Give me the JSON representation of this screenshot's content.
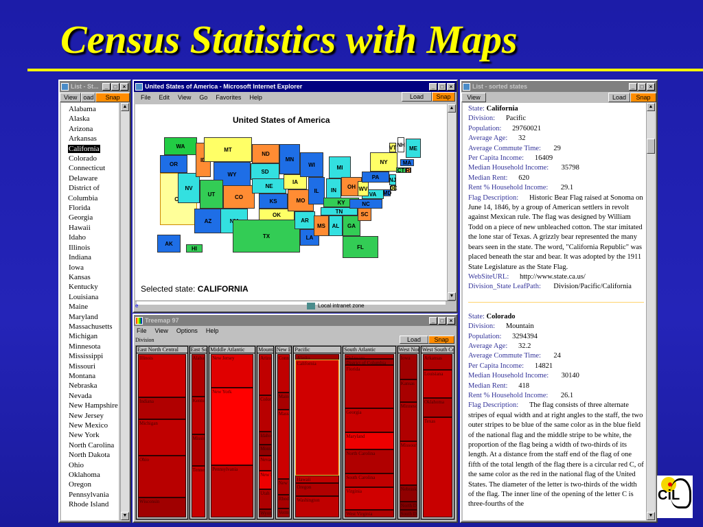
{
  "slide": {
    "title": "Census Statistics with Maps"
  },
  "left_list": {
    "title": "List - St...",
    "view": "View",
    "load": "oad",
    "snap": "Snap",
    "items": [
      "Alabama",
      "Alaska",
      "Arizona",
      "Arkansas",
      "California",
      "Colorado",
      "Connecticut",
      "Delaware",
      "District of Columbia",
      "Florida",
      "Georgia",
      "Hawaii",
      "Idaho",
      "Illinois",
      "Indiana",
      "Iowa",
      "Kansas",
      "Kentucky",
      "Louisiana",
      "Maine",
      "Maryland",
      "Massachusetts",
      "Michigan",
      "Minnesota",
      "Mississippi",
      "Missouri",
      "Montana",
      "Nebraska",
      "Nevada",
      "New Hampshire",
      "New Jersey",
      "New Mexico",
      "New York",
      "North Carolina",
      "North Dakota",
      "Ohio",
      "Oklahoma",
      "Oregon",
      "Pennsylvania",
      "Rhode Island"
    ],
    "selected": "California"
  },
  "ie": {
    "title": "United States of America - Microsoft Internet Explorer",
    "menu": [
      "File",
      "Edit",
      "View",
      "Go",
      "Favorites",
      "Help"
    ],
    "load": "Load",
    "snap": "Snap",
    "map_title": "United States of America",
    "selected_label": "Selected state:",
    "selected_value": "CALIFORNIA",
    "status_zone": "Local intranet zone",
    "states": [
      {
        "id": "WA",
        "color": "#22cc44"
      },
      {
        "id": "OR",
        "color": "#1e6ee6"
      },
      {
        "id": "CA",
        "color": "#ffff99"
      },
      {
        "id": "NV",
        "color": "#33e0e0"
      },
      {
        "id": "ID",
        "color": "#ff8c33"
      },
      {
        "id": "MT",
        "color": "#ffff66"
      },
      {
        "id": "WY",
        "color": "#1e6ee6"
      },
      {
        "id": "UT",
        "color": "#33cc55"
      },
      {
        "id": "AZ",
        "color": "#1e6ee6"
      },
      {
        "id": "CO",
        "color": "#ff8c33"
      },
      {
        "id": "NM",
        "color": "#33e0e0"
      },
      {
        "id": "ND",
        "color": "#ff8c33"
      },
      {
        "id": "SD",
        "color": "#33e0e0"
      },
      {
        "id": "NE",
        "color": "#33e0e0"
      },
      {
        "id": "KS",
        "color": "#1e6ee6"
      },
      {
        "id": "OK",
        "color": "#ffff66"
      },
      {
        "id": "TX",
        "color": "#33cc55"
      },
      {
        "id": "MN",
        "color": "#1e6ee6"
      },
      {
        "id": "IA",
        "color": "#ffff66"
      },
      {
        "id": "MO",
        "color": "#ff8c33"
      },
      {
        "id": "AR",
        "color": "#33e0e0"
      },
      {
        "id": "LA",
        "color": "#1e6ee6"
      },
      {
        "id": "WI",
        "color": "#1e6ee6"
      },
      {
        "id": "IL",
        "color": "#1e6ee6"
      },
      {
        "id": "MI",
        "color": "#33e0e0"
      },
      {
        "id": "IN",
        "color": "#33e0e0"
      },
      {
        "id": "OH",
        "color": "#ff8c33"
      },
      {
        "id": "KY",
        "color": "#33cc55"
      },
      {
        "id": "TN",
        "color": "#33e0e0"
      },
      {
        "id": "MS",
        "color": "#ff8c33"
      },
      {
        "id": "AL",
        "color": "#33e0e0"
      },
      {
        "id": "GA",
        "color": "#33cc55"
      },
      {
        "id": "FL",
        "color": "#33cc55"
      },
      {
        "id": "SC",
        "color": "#ff8c33"
      },
      {
        "id": "NC",
        "color": "#1e6ee6"
      },
      {
        "id": "VA",
        "color": "#33e0e0"
      },
      {
        "id": "WV",
        "color": "#ffff66"
      },
      {
        "id": "PA",
        "color": "#1e6ee6"
      },
      {
        "id": "NY",
        "color": "#ffff66"
      },
      {
        "id": "VT",
        "color": "#ffff66"
      },
      {
        "id": "NH",
        "color": "#ffffff"
      },
      {
        "id": "ME",
        "color": "#33e0e0"
      },
      {
        "id": "MA",
        "color": "#1e6ee6"
      },
      {
        "id": "CT",
        "color": "#33cc55"
      },
      {
        "id": "RI",
        "color": "#ff8c33"
      },
      {
        "id": "NJ",
        "color": "#33e0e0"
      },
      {
        "id": "DE",
        "color": "#ffff66"
      },
      {
        "id": "MD",
        "color": "#1e6ee6"
      },
      {
        "id": "AK",
        "color": "#1e6ee6"
      },
      {
        "id": "HI",
        "color": "#33cc55"
      }
    ]
  },
  "treemap": {
    "title": "Treemap 97",
    "menu": [
      "File",
      "View",
      "Options",
      "Help"
    ],
    "group_label": "Division",
    "load": "Load",
    "snap": "Snap",
    "divisions": [
      {
        "name": "East North Central",
        "states": [
          {
            "n": "Illinois",
            "c": "#cc0000"
          },
          {
            "n": "Indiana",
            "c": "#b00000"
          },
          {
            "n": "Michigan",
            "c": "#c00000"
          },
          {
            "n": "Ohio",
            "c": "#b80000"
          },
          {
            "n": "Wisconsin",
            "c": "#a00000"
          }
        ]
      },
      {
        "name": "East South Central",
        "states": [
          {
            "n": "Alabama",
            "c": "#b00000"
          },
          {
            "n": "Kentucky",
            "c": "#c00000"
          },
          {
            "n": "Mississippi",
            "c": "#b00000"
          },
          {
            "n": "Tennessee",
            "c": "#c80000"
          }
        ]
      },
      {
        "name": "Middle Atlantic",
        "states": [
          {
            "n": "New Jersey",
            "c": "#e00000"
          },
          {
            "n": "New York",
            "c": "#ff0000"
          },
          {
            "n": "Pennsylvania",
            "c": "#c00000"
          }
        ]
      },
      {
        "name": "Mountain",
        "states": [
          {
            "n": "Arizona",
            "c": "#c00000"
          },
          {
            "n": "Colorado",
            "c": "#b80000"
          },
          {
            "n": "Idaho",
            "c": "#a00000"
          },
          {
            "n": "Montana",
            "c": "#900000"
          },
          {
            "n": "Nevada",
            "c": "#c00000"
          },
          {
            "n": "New Mexico",
            "c": "#ee0000"
          },
          {
            "n": "Utah",
            "c": "#b00000"
          },
          {
            "n": "Wyoming",
            "c": "#900000"
          }
        ]
      },
      {
        "name": "New England",
        "states": [
          {
            "n": "Connecticut",
            "c": "#c00000"
          },
          {
            "n": "Maine",
            "c": "#a80000"
          },
          {
            "n": "Massachusetts",
            "c": "#cc0000"
          },
          {
            "n": "New Hampshire",
            "c": "#b00000"
          },
          {
            "n": "Rhode Island",
            "c": "#a80000"
          },
          {
            "n": "Vermont",
            "c": "#a00000"
          }
        ]
      },
      {
        "name": "Pacific",
        "states": [
          {
            "n": "Alaska",
            "c": "#a00000"
          },
          {
            "n": "California",
            "c": "#d00000"
          },
          {
            "n": "Hawaii",
            "c": "#c00000"
          },
          {
            "n": "Oregon",
            "c": "#b00000"
          },
          {
            "n": "Washington",
            "c": "#c00000"
          }
        ]
      },
      {
        "name": "South Atlantic",
        "states": [
          {
            "n": "Delaware",
            "c": "#b00000"
          },
          {
            "n": "District of Columbia",
            "c": "#a00000"
          },
          {
            "n": "Florida",
            "c": "#c00000"
          },
          {
            "n": "Georgia",
            "c": "#c80000"
          },
          {
            "n": "Maryland",
            "c": "#ee0000"
          },
          {
            "n": "North Carolina",
            "c": "#b00000"
          },
          {
            "n": "South Carolina",
            "c": "#c00000"
          },
          {
            "n": "Virginia",
            "c": "#d00000"
          },
          {
            "n": "West Virginia",
            "c": "#b00000"
          }
        ]
      },
      {
        "name": "West North Central",
        "states": [
          {
            "n": "Iowa",
            "c": "#a00000"
          },
          {
            "n": "Kansas",
            "c": "#a80000"
          },
          {
            "n": "Minnesota",
            "c": "#b00000"
          },
          {
            "n": "Missouri",
            "c": "#c00000"
          },
          {
            "n": "Nebraska",
            "c": "#900000"
          },
          {
            "n": "North Dakota",
            "c": "#800000"
          },
          {
            "n": "South Dakota",
            "c": "#800000"
          }
        ]
      },
      {
        "name": "West South Central",
        "states": [
          {
            "n": "Arkansas",
            "c": "#b00000"
          },
          {
            "n": "Louisiana",
            "c": "#c80000"
          },
          {
            "n": "Oklahoma",
            "c": "#b00000"
          },
          {
            "n": "Texas",
            "c": "#c80000"
          }
        ]
      }
    ]
  },
  "right_list": {
    "title": "List - sorted states",
    "view": "View",
    "load": "Load",
    "snap": "Snap",
    "records": [
      {
        "state_label": "State:",
        "state": "California",
        "fields": [
          [
            "Division:",
            "Pacific"
          ],
          [
            "Population:",
            "29760021"
          ],
          [
            "Average Age:",
            "32"
          ],
          [
            "Average Commute Time:",
            "29"
          ],
          [
            "Per Capita Income:",
            "16409"
          ],
          [
            "Median Household Income:",
            "35798"
          ],
          [
            "Median Rent:",
            "620"
          ],
          [
            "Rent % Household Income:",
            "29.1"
          ],
          [
            "Flag Description:",
            "Historic Bear Flag raised at Sonoma on June 14, 1846, by a group of American settlers in revolt against Mexican rule. The flag was designed by William Todd on a piece of new unbleached cotton. The star imitated the lone star of Texas. A grizzly bear represented the many bears seen in the state. The word, \"California Republic\" was placed beneath the star and bear. It was adopted by the 1911 State Legislature as the State Flag."
          ],
          [
            "WebSiteURL:",
            "http://www.state.ca.us/"
          ],
          [
            "Division_State LeafPath:",
            "Division/Pacific/California"
          ]
        ]
      },
      {
        "state_label": "State:",
        "state": "Colorado",
        "fields": [
          [
            "Division:",
            "Mountain"
          ],
          [
            "Population:",
            "3294394"
          ],
          [
            "Average Age:",
            "32.2"
          ],
          [
            "Average Commute Time:",
            "24"
          ],
          [
            "Per Capita Income:",
            "14821"
          ],
          [
            "Median Household Income:",
            "30140"
          ],
          [
            "Median Rent:",
            "418"
          ],
          [
            "Rent % Household Income:",
            "26.1"
          ],
          [
            "Flag Description:",
            "The flag consists of three alternate stripes of equal width and at right angles to the staff, the two outer stripes to be blue of the same color as in the blue field of the national flag and the middle stripe to be white, the proportion of the flag being a width of two-thirds of its length. At a distance from the staff end of the flag of one fifth of the total length of the flag there is a circular red C, of the same color as the red in the national flag of the United States. The diameter of the letter is two-thirds of the width of the flag. The inner line of the opening of the letter C is three-fourths of the"
          ]
        ]
      }
    ]
  },
  "logo": {
    "text": "CIL"
  }
}
